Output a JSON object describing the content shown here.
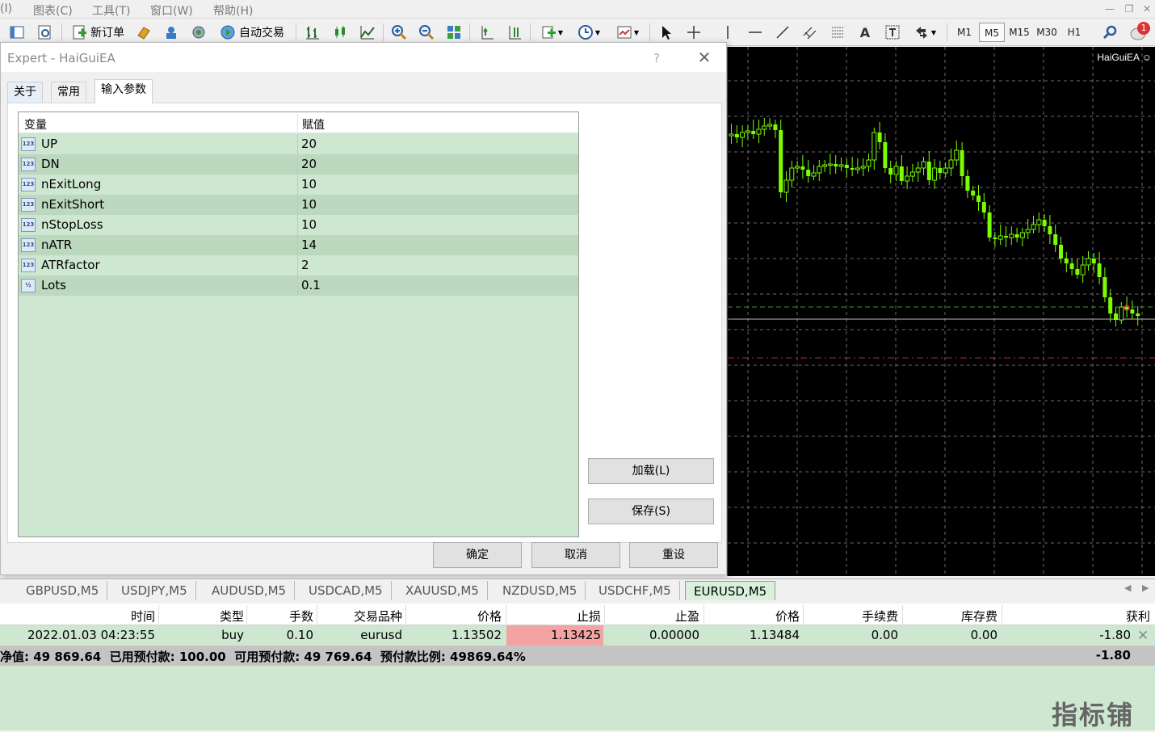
{
  "menu": {
    "items": [
      "(I)",
      "图表(C)",
      "工具(T)",
      "窗口(W)",
      "帮助(H)"
    ]
  },
  "toolbar": {
    "new_order_label": "新订单",
    "autotrade_label": "自动交易",
    "timeframes": [
      "M1",
      "M5",
      "M15",
      "M30",
      "H1"
    ],
    "active_timeframe": "M5",
    "notification_count": "1"
  },
  "chart": {
    "ea_label": "HaiGuiEA",
    "background": "#000000",
    "candle_color": "#7cfc00"
  },
  "dialog": {
    "title": "Expert - HaiGuiEA",
    "help": "?",
    "tabs": [
      "关于",
      "常用",
      "输入参数"
    ],
    "active_tab": "输入参数",
    "columns": [
      "变量",
      "赋值"
    ],
    "params": [
      {
        "icon": "123",
        "name": "UP",
        "value": "20"
      },
      {
        "icon": "123",
        "name": "DN",
        "value": "20"
      },
      {
        "icon": "123",
        "name": "nExitLong",
        "value": "10"
      },
      {
        "icon": "123",
        "name": "nExitShort",
        "value": "10"
      },
      {
        "icon": "123",
        "name": "nStopLoss",
        "value": "10"
      },
      {
        "icon": "123",
        "name": "nATR",
        "value": "14"
      },
      {
        "icon": "123",
        "name": "ATRfactor",
        "value": "2"
      },
      {
        "icon": "½",
        "name": "Lots",
        "value": "0.1"
      }
    ],
    "load_label": "加载(L)",
    "save_label": "保存(S)",
    "ok_label": "确定",
    "cancel_label": "取消",
    "reset_label": "重设"
  },
  "symbol_tabs": [
    "GBPUSD,M5",
    "USDJPY,M5",
    "AUDUSD,M5",
    "USDCAD,M5",
    "XAUUSD,M5",
    "NZDUSD,M5",
    "USDCHF,M5",
    "EURUSD,M5"
  ],
  "active_symbol_tab": "EURUSD,M5",
  "terminal": {
    "columns": [
      "时间",
      "类型",
      "手数",
      "交易品种",
      "价格",
      "止损",
      "止盈",
      "价格",
      "手续费",
      "库存费",
      "获利"
    ],
    "trade": {
      "time": "2022.01.03 04:23:55",
      "type": "buy",
      "lots": "0.10",
      "symbol": "eurusd",
      "open_price": "1.13502",
      "stop_loss": "1.13425",
      "take_profit": "0.00000",
      "price": "1.13484",
      "commission": "0.00",
      "swap": "0.00",
      "profit": "-1.80"
    },
    "summary": "净值: 49 869.64  已用预付款: 100.00  可用预付款: 49 769.64  预付款比例: 49869.64%",
    "summary_profit": "-1.80",
    "stop_loss_color": "#f4a3a3"
  },
  "watermark": "指标铺"
}
